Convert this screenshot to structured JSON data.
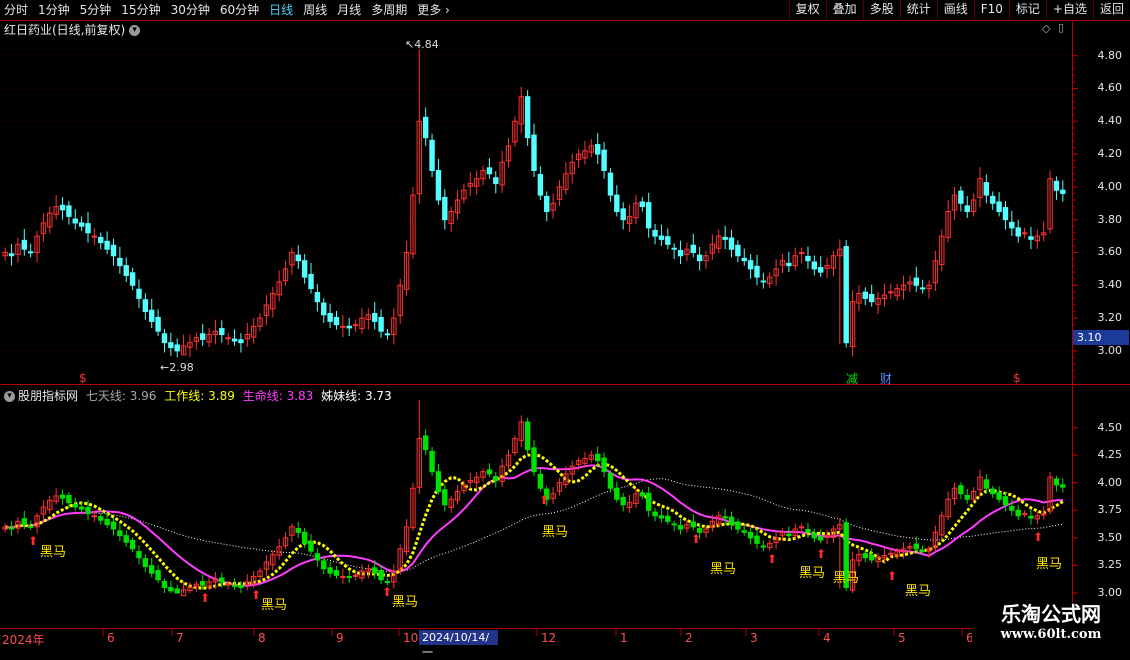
{
  "toolbar": {
    "periods": [
      "分时",
      "1分钟",
      "5分钟",
      "15分钟",
      "30分钟",
      "60分钟",
      "日线",
      "周线",
      "月线",
      "多周期",
      "更多"
    ],
    "active_period": "日线",
    "more_arrow": "›",
    "buttons": [
      "复权",
      "叠加",
      "多股",
      "统计",
      "画线",
      "F10",
      "标记",
      "+自选",
      "返回"
    ]
  },
  "price_panel": {
    "title": "红日药业(日线,前复权)",
    "y_ticks": [
      "4.80",
      "4.60",
      "4.40",
      "4.20",
      "4.00",
      "3.80",
      "3.60",
      "3.40",
      "3.20",
      "3.00"
    ],
    "high_label": "4.84",
    "low_label": "2.98",
    "current_price": "3.10",
    "markers": [
      "$",
      "$",
      "减",
      "财"
    ]
  },
  "indicator_panel": {
    "title": "股朋指标网",
    "lines": [
      {
        "name": "七天线:",
        "value": "3.96",
        "color": "#a8a8a8"
      },
      {
        "name": "工作线:",
        "value": "3.89",
        "color": "#ffff00"
      },
      {
        "name": "生命线:",
        "value": "3.83",
        "color": "#ff3cff"
      },
      {
        "name": "姊妹线:",
        "value": "3.73",
        "color": "#ffffff"
      }
    ],
    "y_ticks": [
      "4.50",
      "4.25",
      "4.00",
      "3.75",
      "3.50",
      "3.25",
      "3.00"
    ],
    "signal_label": "黑马"
  },
  "x_axis": {
    "labels": [
      "2024年",
      "6",
      "7",
      "8",
      "9",
      "10",
      "12",
      "1",
      "2",
      "3",
      "4",
      "5",
      "6"
    ],
    "cursor_date": "2024/10/14/一"
  },
  "watermark": {
    "line1": "乐淘公式网",
    "line2": "www.60lt.com"
  },
  "colors": {
    "up": "#ff3232",
    "down": "#54ffff",
    "indicator_down": "#00e000",
    "axis": "#b40000"
  },
  "chart_data": {
    "type": "candlestick",
    "title": "红日药业(日线,前复权)",
    "ylim": [
      2.92,
      4.92
    ],
    "x_range": [
      "2024年",
      "6"
    ],
    "annotations": {
      "high": 4.84,
      "low": 2.98,
      "last": 3.1
    },
    "closes_approx": [
      3.6,
      3.58,
      3.65,
      3.62,
      3.6,
      3.7,
      3.78,
      3.84,
      3.88,
      3.86,
      3.82,
      3.78,
      3.76,
      3.72,
      3.7,
      3.66,
      3.62,
      3.58,
      3.52,
      3.46,
      3.4,
      3.32,
      3.24,
      3.18,
      3.12,
      3.05,
      3.02,
      3.0,
      3.03,
      3.05,
      3.08,
      3.07,
      3.1,
      3.12,
      3.1,
      3.08,
      3.06,
      3.05,
      3.1,
      3.15,
      3.2,
      3.28,
      3.35,
      3.42,
      3.5,
      3.6,
      3.55,
      3.45,
      3.38,
      3.3,
      3.22,
      3.18,
      3.16,
      3.15,
      3.14,
      3.16,
      3.2,
      3.22,
      3.18,
      3.12,
      3.1,
      3.2,
      3.4,
      3.6,
      3.95,
      4.4,
      4.3,
      4.1,
      3.92,
      3.8,
      3.85,
      3.92,
      3.98,
      4.02,
      4.05,
      4.1,
      4.08,
      4.02,
      4.15,
      4.25,
      4.4,
      4.55,
      4.3,
      4.1,
      3.95,
      3.85,
      3.9,
      4.0,
      4.08,
      4.15,
      4.2,
      4.22,
      4.25,
      4.2,
      4.1,
      3.95,
      3.85,
      3.8,
      3.82,
      3.9,
      3.88,
      3.75,
      3.7,
      3.68,
      3.65,
      3.62,
      3.58,
      3.62,
      3.6,
      3.55,
      3.58,
      3.65,
      3.7,
      3.68,
      3.62,
      3.58,
      3.55,
      3.5,
      3.45,
      3.42,
      3.45,
      3.5,
      3.55,
      3.52,
      3.58,
      3.6,
      3.55,
      3.5,
      3.48,
      3.52,
      3.58,
      3.62,
      3.05,
      3.3,
      3.35,
      3.32,
      3.3,
      3.32,
      3.34,
      3.36,
      3.38,
      3.4,
      3.42,
      3.4,
      3.38,
      3.4,
      3.55,
      3.7,
      3.85,
      3.95,
      3.9,
      3.85,
      3.92,
      4.05,
      3.95,
      3.9,
      3.85,
      3.8,
      3.75,
      3.7,
      3.72,
      3.68,
      3.7,
      3.72,
      4.05,
      3.98,
      3.96
    ]
  }
}
